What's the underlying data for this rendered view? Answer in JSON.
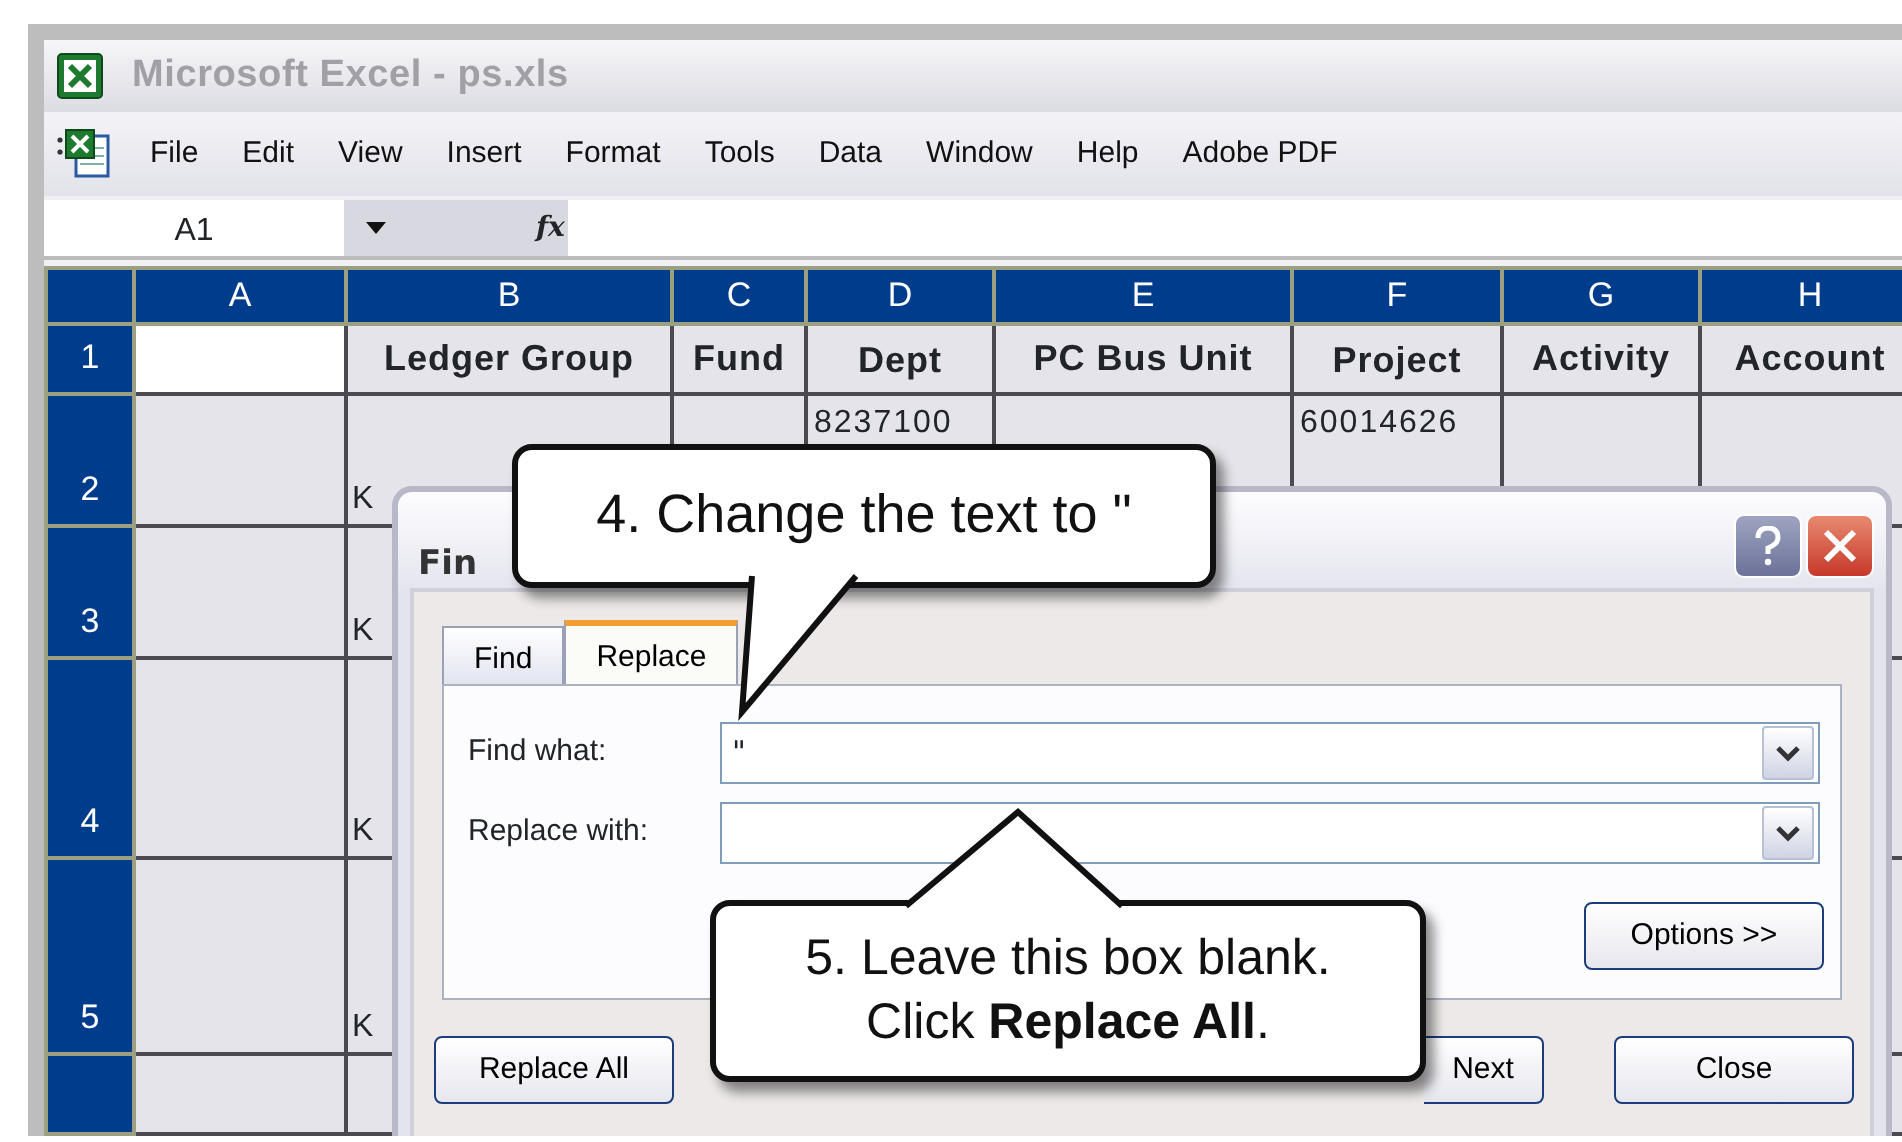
{
  "window": {
    "title": "Microsoft Excel - ps.xls"
  },
  "menu": [
    "File",
    "Edit",
    "View",
    "Insert",
    "Format",
    "Tools",
    "Data",
    "Window",
    "Help",
    "Adobe PDF"
  ],
  "formula_bar": {
    "name_box": "A1",
    "fx": "fx"
  },
  "sheet": {
    "columns": [
      "A",
      "B",
      "C",
      "D",
      "E",
      "F",
      "G",
      "H"
    ],
    "rows": [
      {
        "header": "1",
        "cells": [
          "",
          "Ledger Group",
          "Fund",
          "Dept",
          "PC Bus Unit",
          "Project",
          "Activity",
          "Account"
        ]
      },
      {
        "header": "2",
        "cells": [
          "",
          "K",
          "",
          "8237100",
          "",
          "60014626",
          "",
          ""
        ]
      },
      {
        "header": "3",
        "cells": [
          "",
          "K",
          "",
          "",
          "",
          "",
          "",
          ""
        ]
      },
      {
        "header": "4",
        "cells": [
          "",
          "K",
          "",
          "",
          "",
          "",
          "",
          ""
        ]
      },
      {
        "header": "5",
        "cells": [
          "",
          "K",
          "",
          "",
          "",
          "",
          "",
          ""
        ]
      }
    ]
  },
  "dialog": {
    "title": "Fin",
    "tabs": [
      {
        "label": "Find",
        "selected": false
      },
      {
        "label": "Replace",
        "selected": true
      }
    ],
    "fields": [
      {
        "label": "Find what:",
        "value": "\""
      },
      {
        "label": "Replace with:"
      }
    ],
    "options_button": "Options >>",
    "buttons": [
      {
        "label": "Replace All"
      },
      {
        "label": "Next"
      },
      {
        "label": "Close"
      }
    ]
  },
  "callouts": [
    {
      "text": "4. Change the text to \""
    },
    {
      "text": "5. Leave this box blank.\nClick **Replace All**."
    }
  ]
}
